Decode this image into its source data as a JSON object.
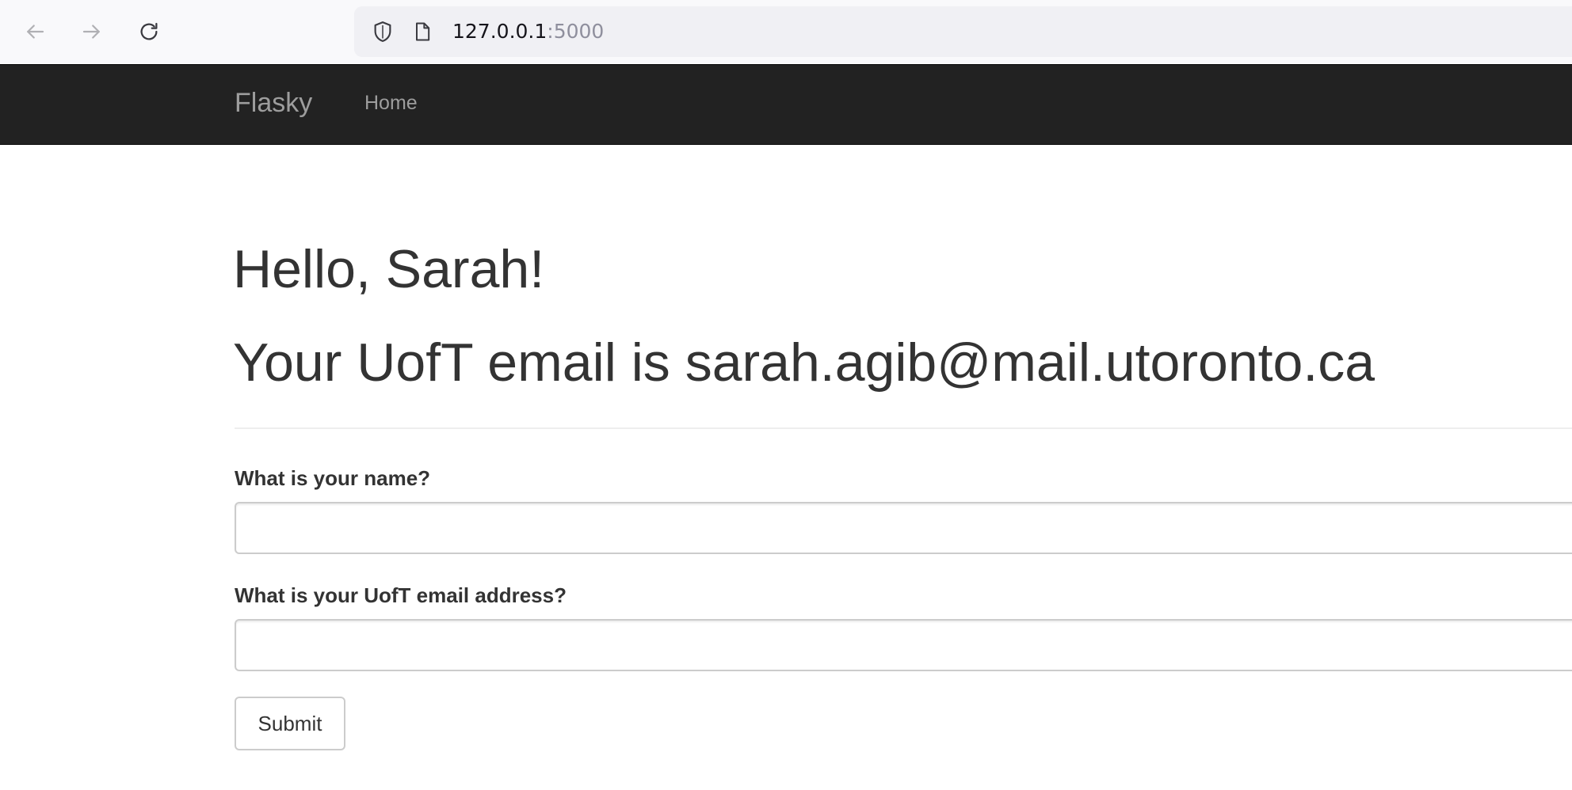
{
  "browser": {
    "url_host": "127.0.0.1",
    "url_port": ":5000",
    "icons": {
      "back": "back-arrow-icon",
      "forward": "forward-arrow-icon",
      "reload": "reload-icon",
      "shield": "shield-icon",
      "page": "page-icon"
    }
  },
  "navbar": {
    "brand": "Flasky",
    "items": [
      {
        "label": "Home"
      }
    ],
    "background": "#222222",
    "link_color": "#9d9d9d"
  },
  "main": {
    "greeting": "Hello, Sarah!",
    "email_message": "Your UofT email is sarah.agib@mail.utoronto.ca"
  },
  "form": {
    "name_label": "What is your name?",
    "name_value": "",
    "email_label": "What is your UofT email address?",
    "email_value": "",
    "submit_label": "Submit"
  }
}
